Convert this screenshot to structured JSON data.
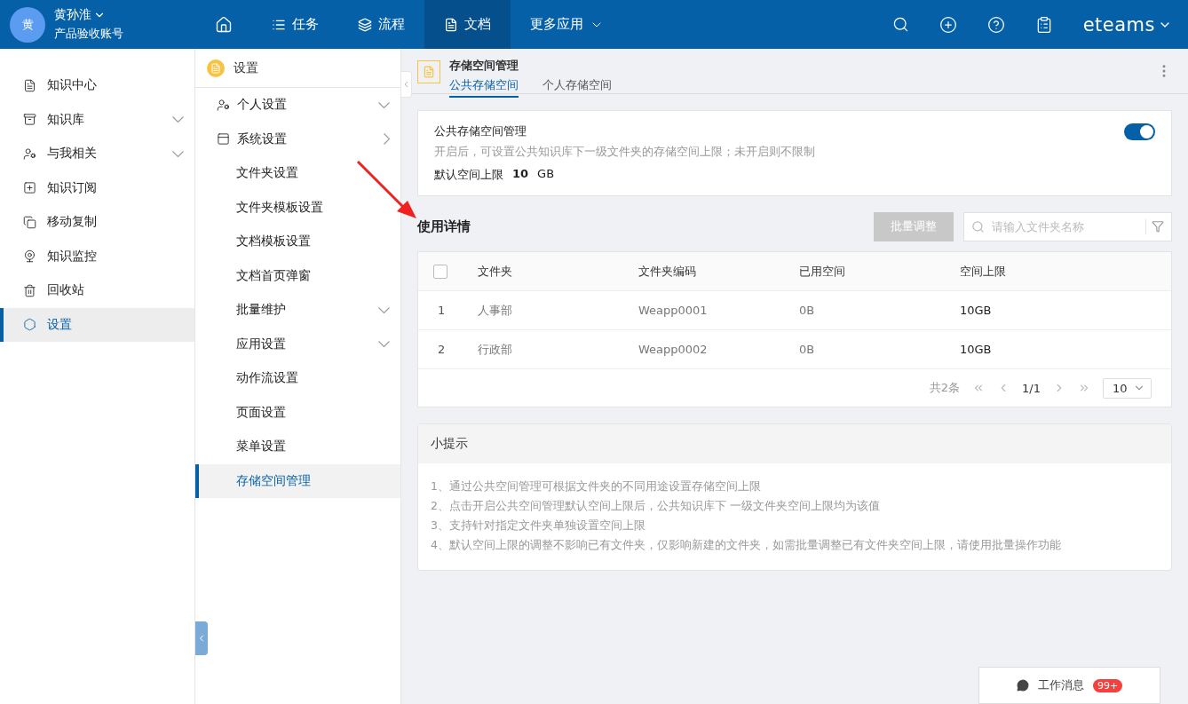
{
  "user": {
    "avatar": "黄",
    "name": "黄孙淮",
    "account": "产品验收账号"
  },
  "nav": [
    {
      "kind": "home",
      "selected": false
    },
    {
      "kind": "list",
      "label": "任务",
      "selected": false
    },
    {
      "kind": "layers",
      "label": "流程",
      "selected": false
    },
    {
      "kind": "doc",
      "label": "文档",
      "selected": true
    },
    {
      "kind": "more",
      "label": "更多应用",
      "selected": false
    }
  ],
  "brand": "eteams",
  "sidebar": {
    "items": [
      {
        "label": "知识中心",
        "expandable": false,
        "selected": false
      },
      {
        "label": "知识库",
        "expandable": true,
        "selected": false
      },
      {
        "label": "与我相关",
        "expandable": true,
        "selected": false
      },
      {
        "label": "知识订阅",
        "expandable": false,
        "selected": false
      },
      {
        "label": "移动复制",
        "expandable": false,
        "selected": false
      },
      {
        "label": "知识监控",
        "expandable": false,
        "selected": false
      },
      {
        "label": "回收站",
        "expandable": false,
        "selected": false
      },
      {
        "label": "设置",
        "expandable": false,
        "selected": true
      }
    ]
  },
  "settings_menu": {
    "title": "设置",
    "items": [
      {
        "label": "个人设置",
        "expanded": false,
        "selected": false
      },
      {
        "label": "系统设置",
        "expanded": true,
        "selected": false,
        "children": [
          {
            "label": "文件夹设置",
            "selected": false
          },
          {
            "label": "文件夹模板设置",
            "selected": false
          },
          {
            "label": "文档模板设置",
            "selected": false
          },
          {
            "label": "文档首页弹窗",
            "selected": false
          },
          {
            "label": "批量维护",
            "expanded": false,
            "selected": false
          },
          {
            "label": "应用设置",
            "expanded": false,
            "selected": false
          },
          {
            "label": "动作流设置",
            "selected": false
          },
          {
            "label": "页面设置",
            "selected": false
          },
          {
            "label": "菜单设置",
            "selected": false
          },
          {
            "label": "存储空间管理",
            "selected": true
          }
        ]
      }
    ]
  },
  "page": {
    "title": "存储空间管理",
    "tabs": [
      {
        "label": "公共存储空间",
        "selected": true
      },
      {
        "label": "个人存储空间",
        "selected": false
      }
    ]
  },
  "storage_card": {
    "title": "公共存储空间管理",
    "on": true,
    "description": "开启后，可设置公共知识库下一级文件夹的存储空间上限；未开启则不限制",
    "limit_label": "默认空间上限",
    "limit_value": "10",
    "limit_unit": "GB"
  },
  "usage": {
    "title": "使用详情",
    "batch_button": {
      "label": "批量调整",
      "disabled": true
    },
    "search": {
      "placeholder": "请输入文件夹名称"
    },
    "table": {
      "columns": [
        "文件夹",
        "文件夹编码",
        "已用空间",
        "空间上限"
      ],
      "all_checked": false,
      "rows": [
        {
          "index": "1",
          "cells": [
            "人事部",
            "Weapp0001",
            "0B",
            "10GB"
          ]
        },
        {
          "index": "2",
          "cells": [
            "行政部",
            "Weapp0002",
            "0B",
            "10GB"
          ]
        }
      ]
    },
    "pagination": {
      "total": "共2条",
      "page": "1/1",
      "page_size": "10"
    }
  },
  "tips": {
    "title": "小提示",
    "lines": [
      "1、通过公共空间管理可根据文件夹的不同用途设置存储空间上限",
      "2、点击开启公共空间管理默认空间上限后，公共知识库下 一级文件夹空间上限均为该值",
      "3、支持针对指定文件夹单独设置空间上限",
      "4、默认空间上限的调整不影响已有文件夹，仅影响新建的文件夹，如需批量调整已有文件夹空间上限，请使用批量操作功能"
    ]
  },
  "messages": {
    "label": "工作消息",
    "badge": "99+"
  }
}
